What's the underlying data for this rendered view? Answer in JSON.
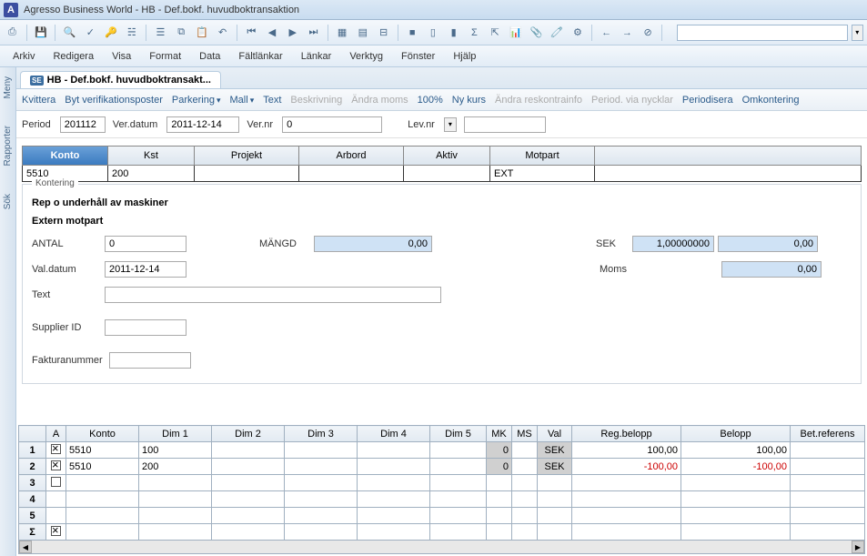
{
  "window": {
    "app_letter": "A",
    "title": "Agresso Business World - HB - Def.bokf. huvudboktransaktion"
  },
  "menubar": [
    "Arkiv",
    "Redigera",
    "Visa",
    "Format",
    "Data",
    "Fältlänkar",
    "Länkar",
    "Verktyg",
    "Fönster",
    "Hjälp"
  ],
  "sidebar": [
    "Meny",
    "Rapporter",
    "Sök"
  ],
  "tab": {
    "badge": "SE",
    "label": "HB - Def.bokf. huvudboktransakt..."
  },
  "actions": [
    {
      "label": "Kvittera",
      "enabled": true
    },
    {
      "label": "Byt verifikationsposter",
      "enabled": true
    },
    {
      "label": "Parkering",
      "enabled": true,
      "dropdown": true
    },
    {
      "label": "Mall",
      "enabled": true,
      "dropdown": true
    },
    {
      "label": "Text",
      "enabled": true
    },
    {
      "label": "Beskrivning",
      "enabled": false
    },
    {
      "label": "Ändra moms",
      "enabled": false
    },
    {
      "label": "100%",
      "enabled": true
    },
    {
      "label": "Ny kurs",
      "enabled": true
    },
    {
      "label": "Ändra reskontrainfo",
      "enabled": false
    },
    {
      "label": "Period. via nycklar",
      "enabled": false
    },
    {
      "label": "Periodisera",
      "enabled": true
    },
    {
      "label": "Omkontering",
      "enabled": true
    }
  ],
  "header": {
    "period_label": "Period",
    "period_value": "201112",
    "verdatum_label": "Ver.datum",
    "verdatum_value": "2011-12-14",
    "vernr_label": "Ver.nr",
    "vernr_value": "0",
    "levnr_label": "Lev.nr",
    "levnr_value": ""
  },
  "entry_cols": [
    "Konto",
    "Kst",
    "Projekt",
    "Arbord",
    "Aktiv",
    "Motpart"
  ],
  "entry_row": {
    "konto": "5510",
    "kst": "200",
    "projekt": "",
    "arbord": "",
    "aktiv": "",
    "motpart": "EXT"
  },
  "detail": {
    "kontering_label": "Kontering",
    "line1": "Rep o underhåll av maskiner",
    "line2": "Extern motpart",
    "antal_label": "ANTAL",
    "antal_value": "0",
    "mangd_label": "MÄNGD",
    "mangd_value": "0,00",
    "sek_label": "SEK",
    "sek_rate": "1,00000000",
    "sek_value": "0,00",
    "valdatum_label": "Val.datum",
    "valdatum_value": "2011-12-14",
    "moms_label": "Moms",
    "moms_value": "0,00",
    "text_label": "Text",
    "text_value": "",
    "supplier_label": "Supplier ID",
    "supplier_value": "",
    "faktura_label": "Fakturanummer",
    "faktura_value": ""
  },
  "grid": {
    "headers": [
      "",
      "A",
      "Konto",
      "Dim 1",
      "Dim 2",
      "Dim 3",
      "Dim 4",
      "Dim 5",
      "MK",
      "MS",
      "Val",
      "Reg.belopp",
      "Belopp",
      "Bet.referens"
    ],
    "rows": [
      {
        "num": "1",
        "a": true,
        "konto": "5510",
        "dim1": "100",
        "dim2": "",
        "dim3": "",
        "dim4": "",
        "dim5": "",
        "mk": "0",
        "ms": "",
        "val": "SEK",
        "reg": "100,00",
        "belopp": "100,00",
        "ref": "",
        "neg": false
      },
      {
        "num": "2",
        "a": true,
        "konto": "5510",
        "dim1": "200",
        "dim2": "",
        "dim3": "",
        "dim4": "",
        "dim5": "",
        "mk": "0",
        "ms": "",
        "val": "SEK",
        "reg": "-100,00",
        "belopp": "-100,00",
        "ref": "",
        "neg": true
      },
      {
        "num": "3",
        "a": false
      },
      {
        "num": "4",
        "a": false,
        "nocheck": true
      },
      {
        "num": "5",
        "a": false,
        "nocheck": true
      }
    ],
    "sigma": "Σ"
  }
}
